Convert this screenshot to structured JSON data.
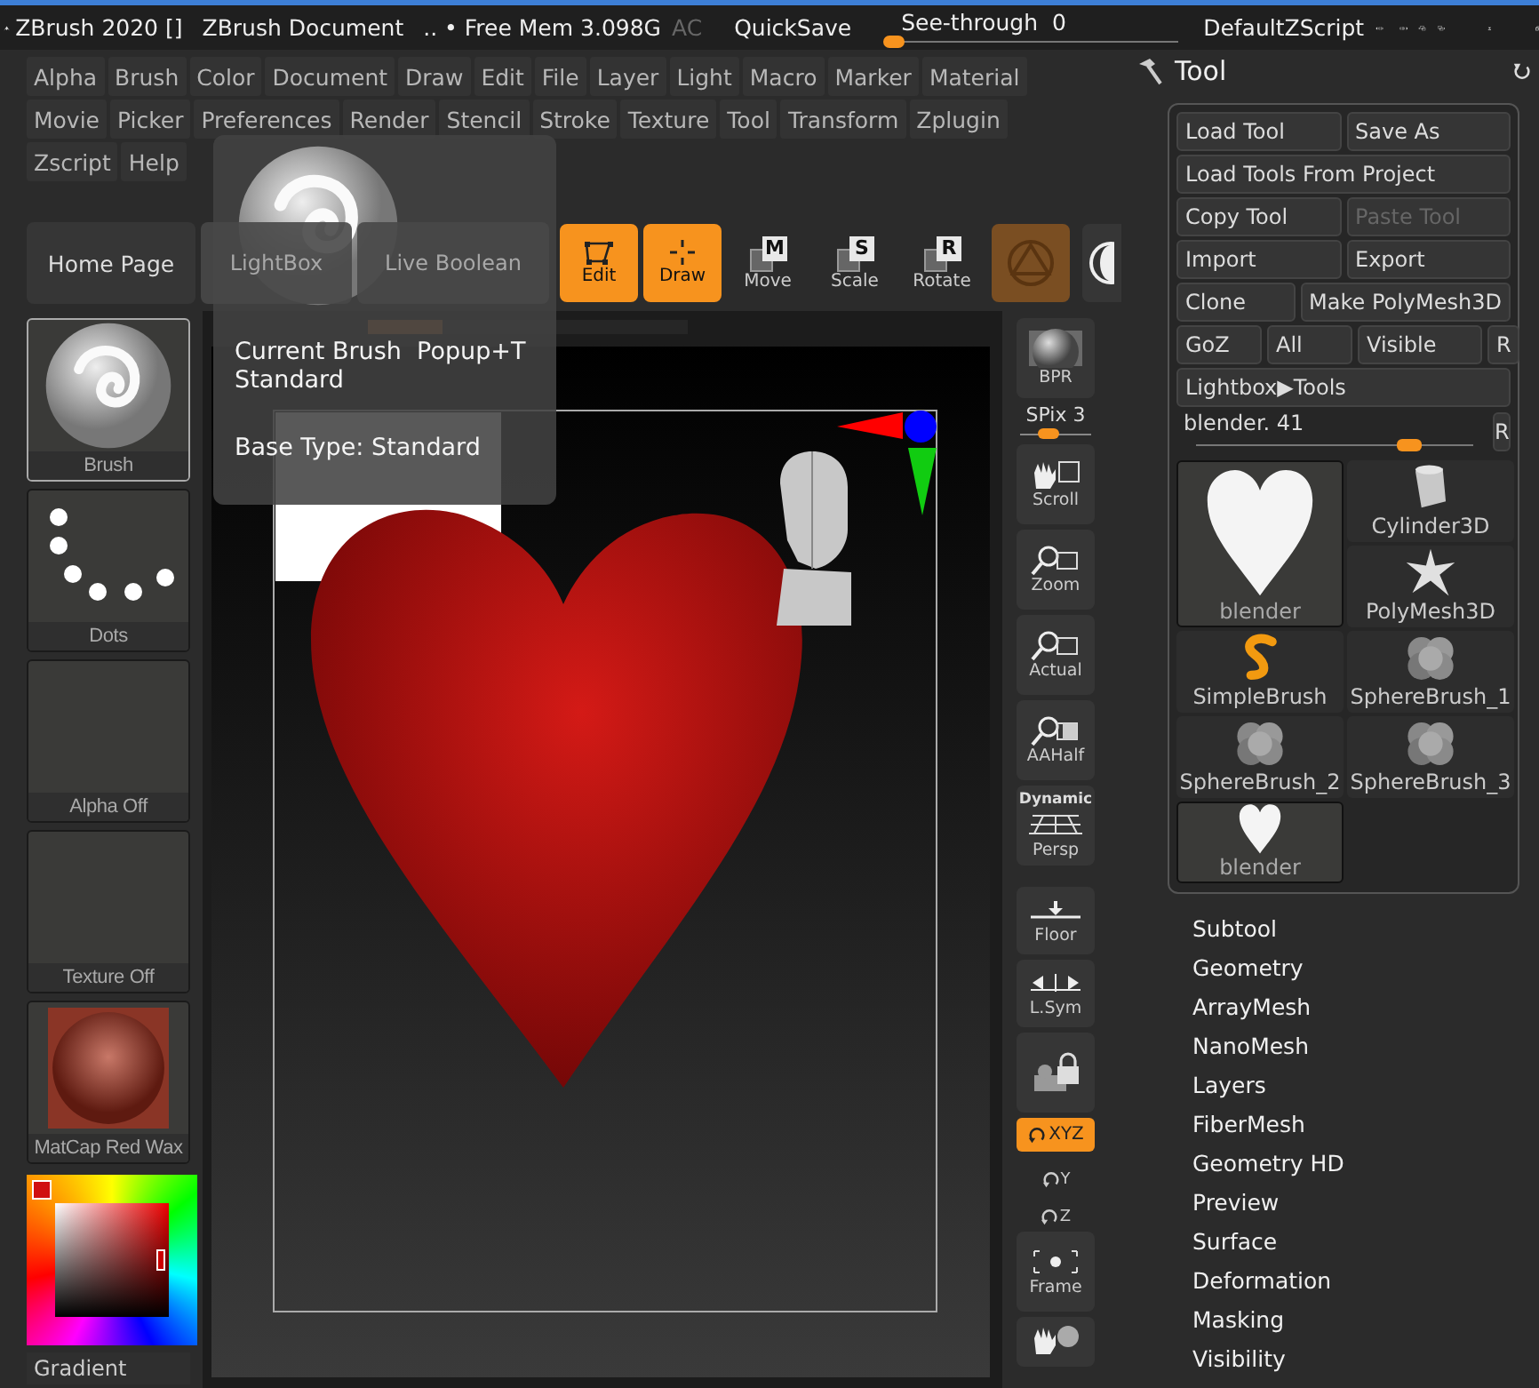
{
  "title_bar": {
    "app": "ZBrush 2020 []",
    "document": "ZBrush Document",
    "memory": ".. • Free Mem 3.098G",
    "ac": "AC",
    "quicksave": "QuickSave",
    "see_through": {
      "label": "See-through",
      "value": "0",
      "level": 0
    },
    "script": "DefaultZScript"
  },
  "menus": [
    [
      "Alpha",
      "Brush",
      "Color",
      "Document",
      "Draw",
      "Edit",
      "File",
      "Layer",
      "Light",
      "Macro",
      "Marker",
      "Material"
    ],
    [
      "Movie",
      "Picker",
      "Preferences",
      "Render",
      "Stencil",
      "Stroke",
      "Texture",
      "Tool",
      "Transform",
      "Zplugin"
    ],
    [
      "Zscript",
      "Help"
    ]
  ],
  "toolbar": [
    {
      "kind": "text",
      "label": "Home Page",
      "selected": false
    },
    {
      "kind": "faded",
      "label": "LightBox"
    },
    {
      "kind": "faded",
      "label": "Live Boolean"
    },
    {
      "kind": "edit",
      "label": "Edit",
      "selected": true
    },
    {
      "kind": "draw",
      "label": "Draw",
      "selected": true
    },
    {
      "kind": "transform",
      "label": "Move",
      "key": "M",
      "selected": false
    },
    {
      "kind": "transform",
      "label": "Scale",
      "key": "S",
      "selected": false
    },
    {
      "kind": "transform",
      "label": "Rotate",
      "key": "R",
      "selected": false
    },
    {
      "kind": "material",
      "selected": true
    },
    {
      "kind": "sphere"
    }
  ],
  "tooltip": {
    "title": "Current Brush  Popup+T",
    "name": "Standard",
    "detail": "Base Type: Standard"
  },
  "left_shelf": [
    {
      "kind": "brush",
      "label": "Brush",
      "selected": true
    },
    {
      "kind": "dots",
      "label": "Dots",
      "selected": false
    },
    {
      "kind": "empty",
      "label": "Alpha Off",
      "selected": false
    },
    {
      "kind": "empty",
      "label": "Texture Off",
      "selected": false
    },
    {
      "kind": "matcap",
      "label": "MatCap Red Wax",
      "selected": false
    }
  ],
  "color_picker": {
    "label": "Gradient",
    "color": "#d01010"
  },
  "right_shelf": [
    {
      "kind": "bpr",
      "label": "BPR",
      "selected": false
    },
    {
      "kind": "slider",
      "label": "SPix 3",
      "level": 0.4
    },
    {
      "kind": "scroll",
      "label": "Scroll",
      "selected": false
    },
    {
      "kind": "zoom",
      "label": "Zoom",
      "selected": false
    },
    {
      "kind": "actual",
      "label": "Actual",
      "selected": false
    },
    {
      "kind": "aahalf",
      "label": "AAHalf",
      "selected": false
    },
    {
      "kind": "persp",
      "label": "Persp",
      "top": "Dynamic",
      "selected": false
    },
    {
      "kind": "floor",
      "label": "Floor",
      "selected": false
    },
    {
      "kind": "lsym",
      "label": "L.Sym",
      "selected": false
    },
    {
      "kind": "camera",
      "selected": false
    },
    {
      "kind": "xyz",
      "label": "XYZ",
      "selected": true
    },
    {
      "kind": "axis",
      "label": "Y",
      "selected": false
    },
    {
      "kind": "axis",
      "label": "Z",
      "selected": false
    },
    {
      "kind": "frame",
      "label": "Frame",
      "selected": false
    },
    {
      "kind": "handsphere",
      "selected": false
    }
  ],
  "tool_panel": {
    "title": "Tool",
    "rows": [
      [
        {
          "label": "Load Tool",
          "disabled": false
        },
        {
          "label": "Save As",
          "disabled": false
        }
      ],
      [
        {
          "label": "Load Tools From Project",
          "disabled": false
        }
      ],
      [
        {
          "label": "Copy Tool",
          "disabled": false
        },
        {
          "label": "Paste Tool",
          "disabled": true
        }
      ],
      [
        {
          "label": "Import",
          "disabled": false
        },
        {
          "label": "Export",
          "disabled": false
        }
      ],
      [
        {
          "label": "Clone",
          "disabled": false
        },
        {
          "label": "Make PolyMesh3D",
          "disabled": false
        }
      ],
      [
        {
          "label": "GoZ",
          "disabled": false
        },
        {
          "label": "All",
          "disabled": false
        },
        {
          "label": "Visible",
          "disabled": false
        },
        {
          "label": "R",
          "disabled": false
        }
      ],
      [
        {
          "label": "Lightbox▶Tools",
          "disabled": false
        }
      ]
    ],
    "slider": {
      "label": "blender. 41",
      "level": 0.77,
      "reset": "R"
    },
    "tools": [
      {
        "kind": "cylinder",
        "label": "Cylinder3D",
        "selected": false,
        "large": false
      },
      {
        "kind": "heart",
        "label": "blender",
        "selected": true,
        "large": true
      },
      {
        "kind": "star",
        "label": "PolyMesh3D",
        "selected": false,
        "large": false
      },
      {
        "kind": "sbrush",
        "label": "SimpleBrush",
        "selected": false,
        "large": false
      },
      {
        "kind": "cluster",
        "label": "SphereBrush_1",
        "selected": false,
        "large": false
      },
      {
        "kind": "cluster",
        "label": "SphereBrush_2",
        "selected": false,
        "large": false
      },
      {
        "kind": "cluster",
        "label": "SphereBrush_3",
        "selected": false,
        "large": false
      },
      {
        "kind": "heart",
        "label": "blender",
        "selected": true,
        "large": false
      }
    ],
    "sections": [
      "Subtool",
      "Geometry",
      "ArrayMesh",
      "NanoMesh",
      "Layers",
      "FiberMesh",
      "Geometry HD",
      "Preview",
      "Surface",
      "Deformation",
      "Masking",
      "Visibility"
    ]
  }
}
